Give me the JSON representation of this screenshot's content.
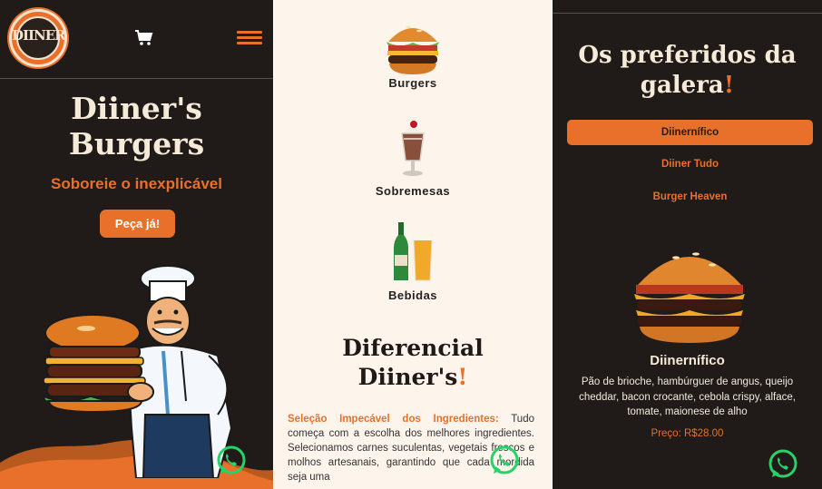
{
  "colors": {
    "accent": "#e8702a",
    "dark_bg": "#201b18",
    "cream_bg": "#fdf4ec",
    "cream_text": "#f6ead8",
    "whatsapp": "#25d366"
  },
  "panel_home": {
    "logo_text": "DIINER",
    "cart_icon": "cart-icon",
    "menu_icon": "hamburger-menu-icon",
    "hero_title_line1": "Diiner's",
    "hero_title_line2": "Burgers",
    "hero_subtitle": "Soboreie o inexplicável",
    "order_button": "Peça já!"
  },
  "panel_categories": {
    "categories": [
      {
        "label": "Burgers",
        "icon": "burger-icon"
      },
      {
        "label": "Sobremesas",
        "icon": "milkshake-icon"
      },
      {
        "label": "Bebidas",
        "icon": "beer-icon"
      }
    ],
    "diferencial_title_line1": "Diferencial",
    "diferencial_title_line2": "Diiner's",
    "diferencial_bang": "!",
    "diferencial_highlight": "Seleção Impecável dos Ingredientes:",
    "diferencial_text": " Tudo começa com a escolha dos melhores ingredientes. Selecionamos carnes suculentas, vegetais frescos e molhos artesanais, garantindo que cada mordida seja uma"
  },
  "panel_favorites": {
    "title_line1": "Os preferidos da",
    "title_line2": "galera",
    "title_bang": "!",
    "tabs": [
      {
        "label": "Diinernífico",
        "active": true
      },
      {
        "label": "Diiner Tudo",
        "active": false
      },
      {
        "label": "Burger Heaven",
        "active": false
      }
    ],
    "product_name": "Diinernífico",
    "product_description": "Pão de brioche, hambúrguer de angus, queijo cheddar, bacon crocante, cebola crispy, alface, tomate, maionese de alho",
    "product_price": "Preço: R$28.00"
  },
  "whatsapp_icon": "whatsapp-icon"
}
